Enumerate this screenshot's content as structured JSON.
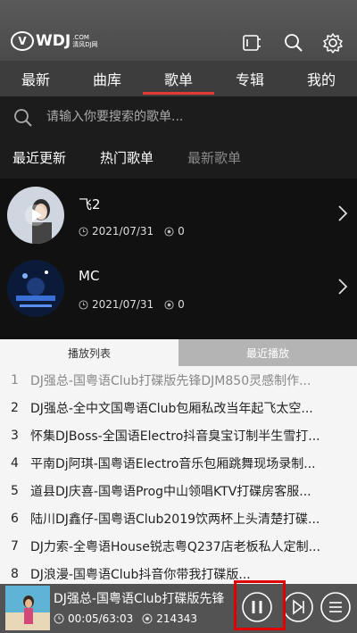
{
  "app": {
    "logo_mark": "V",
    "logo_text": "WDJ",
    "logo_dot_com": ".COM",
    "logo_cn": "清风DJ网"
  },
  "nav": {
    "tabs": [
      {
        "label": "最新"
      },
      {
        "label": "曲库"
      },
      {
        "label": "歌单"
      },
      {
        "label": "专辑"
      },
      {
        "label": "我的"
      }
    ],
    "active_index": 2
  },
  "search": {
    "placeholder": "请输入你要搜索的歌单..."
  },
  "filters": [
    {
      "label": "最近更新"
    },
    {
      "label": "热门歌单"
    },
    {
      "label": "最新歌单"
    }
  ],
  "playlists": [
    {
      "title": "飞2",
      "date": "2021/07/31",
      "count": "0"
    },
    {
      "title": "MC",
      "date": "2021/07/31",
      "count": "0"
    }
  ],
  "sheet": {
    "tab_queue": "播放列表",
    "tab_recent": "最近播放",
    "tracks": [
      {
        "num": "1",
        "title": "DJ强总-国粤语Club打碟版先锋DJM850灵感制作..."
      },
      {
        "num": "2",
        "title": "DJ强总-全中文国粤语Club包厢私改当年起飞太空..."
      },
      {
        "num": "3",
        "title": "怀集DJBoss-全国语Electro抖音臭宝订制半生雪打..."
      },
      {
        "num": "4",
        "title": "平南Dj阿琪-国粤语Electro音乐包厢跳舞现场录制..."
      },
      {
        "num": "5",
        "title": "道县DJ庆喜-国粤语Prog中山领唱KTV打碟房客服..."
      },
      {
        "num": "6",
        "title": "陆川DJ鑫仔-国粤语Club2019饮两杯上头清楚打碟..."
      },
      {
        "num": "7",
        "title": "DJ力索-全粤语House锐志粤Q237店老板私人定制..."
      },
      {
        "num": "8",
        "title": "DJ浪漫-国粤语Club抖音你带我打碟版..."
      }
    ]
  },
  "player": {
    "song": "DJ强总-国粤语Club打碟版先锋",
    "time": "00:05/63:03",
    "plays": "214343"
  },
  "colors": {
    "accent": "#e53935",
    "header": "#4a4a4a",
    "nav": "#3d3d3d",
    "player": "#535353",
    "highlight": "#e00000"
  }
}
